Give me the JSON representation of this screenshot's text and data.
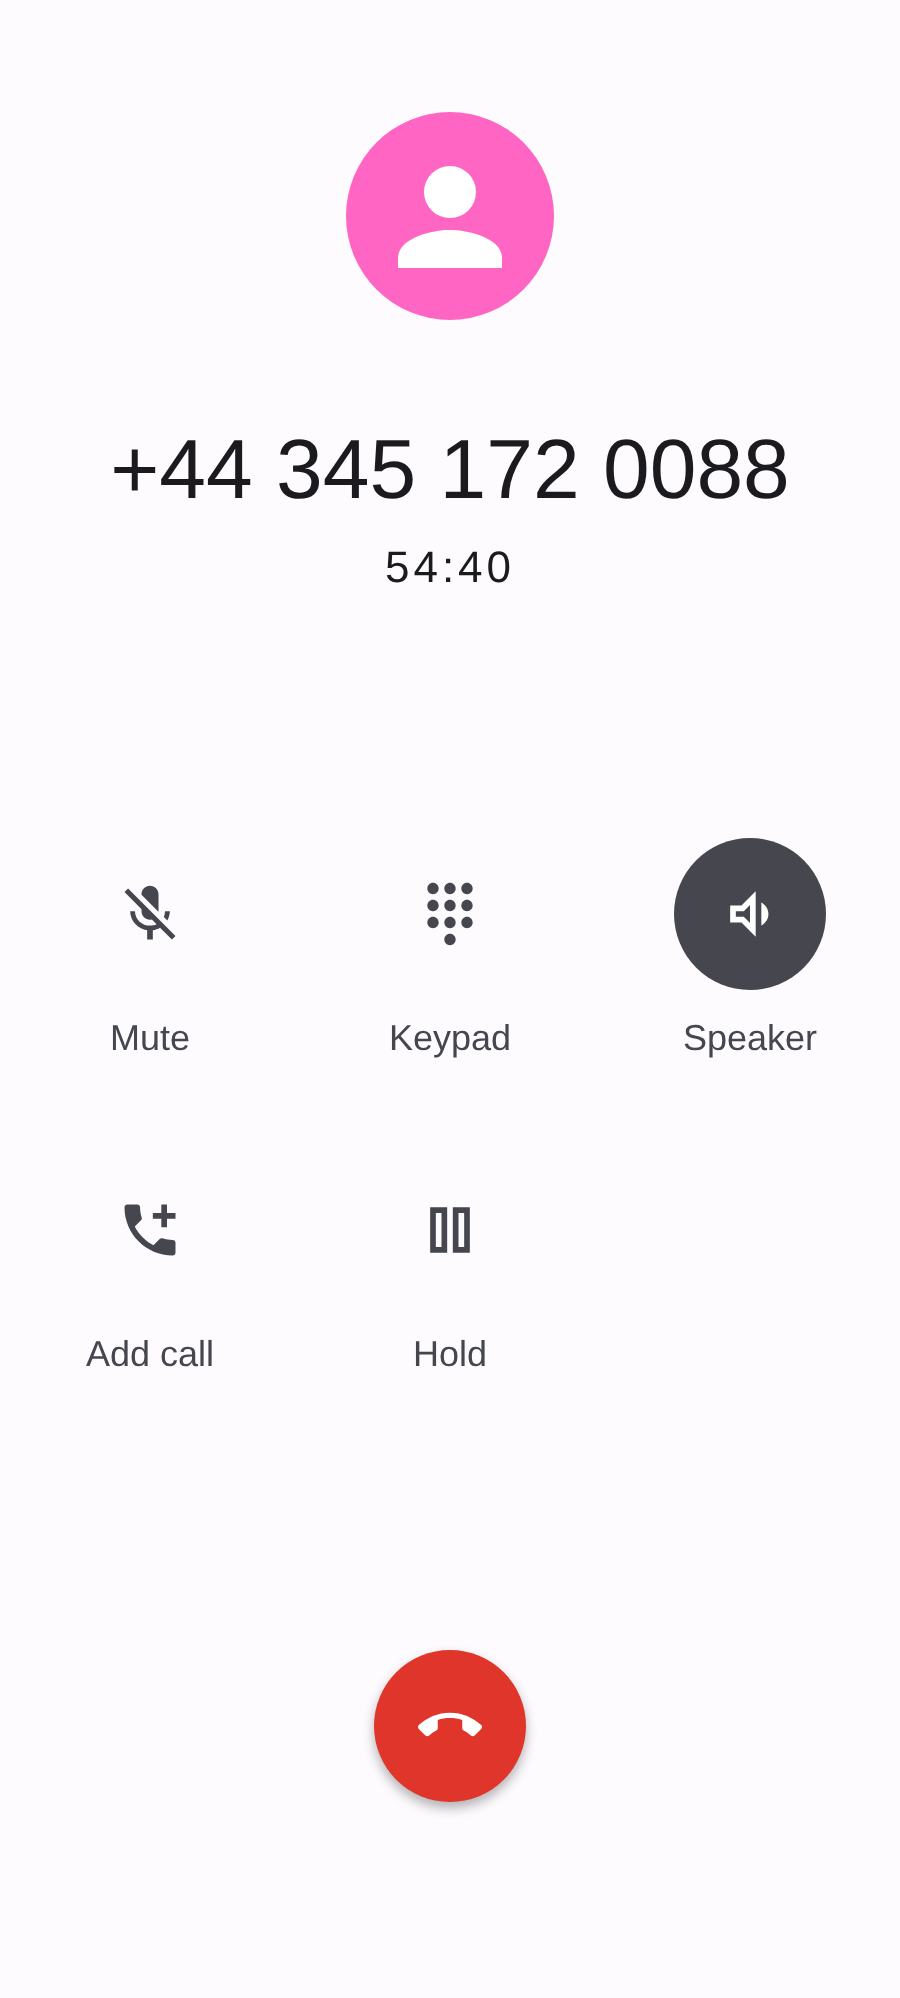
{
  "caller": {
    "number": "+44 345 172 0088",
    "duration": "54:40"
  },
  "controls": [
    {
      "label": "Mute",
      "kind": "mic_off",
      "selected": false
    },
    {
      "label": "Keypad",
      "kind": "dialpad",
      "selected": false
    },
    {
      "label": "Speaker",
      "kind": "speaker",
      "selected": true
    },
    {
      "label": "Add call",
      "kind": "add_call",
      "selected": false
    },
    {
      "label": "Hold",
      "kind": "pause",
      "selected": false
    }
  ]
}
